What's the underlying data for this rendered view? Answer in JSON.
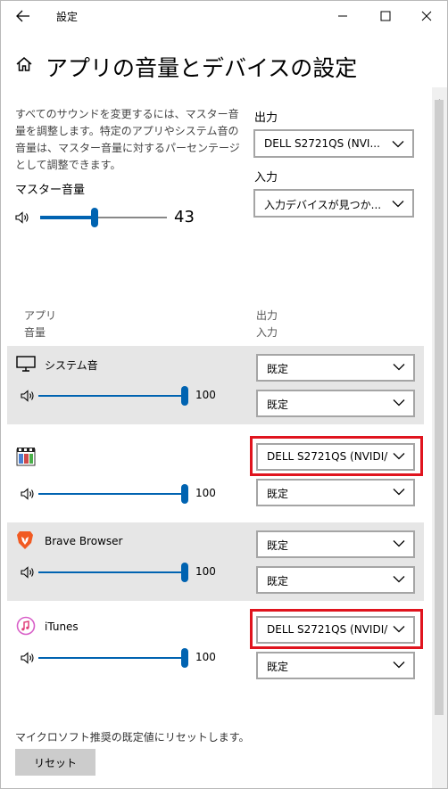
{
  "window": {
    "title": "設定"
  },
  "page": {
    "title": "アプリの音量とデバイスの設定"
  },
  "master": {
    "description": "すべてのサウンドを変更するには、マスター音量を調整します。特定のアプリやシステム音の音量は、マスター音量に対するパーセンテージとして調整できます。",
    "label": "マスター音量",
    "value": "43",
    "level": 43
  },
  "output": {
    "label": "出力",
    "selected": "DELL S2721QS (NVI..."
  },
  "input": {
    "label": "入力",
    "selected": "入力デバイスが見つか..."
  },
  "columns": {
    "app": "アプリ",
    "volume": "音量",
    "output": "出力",
    "input": "入力"
  },
  "apps": [
    {
      "name": "システム音",
      "icon": "monitor-icon",
      "volume": "100",
      "level": 100,
      "output": "既定",
      "input": "既定"
    },
    {
      "name": "",
      "icon": "media-player-classic-icon",
      "volume": "100",
      "level": 100,
      "output": "DELL S2721QS (NVIDI/",
      "input": "既定"
    },
    {
      "name": "Brave Browser",
      "icon": "brave-lion-icon",
      "volume": "100",
      "level": 100,
      "output": "既定",
      "input": "既定"
    },
    {
      "name": "iTunes",
      "icon": "itunes-icon",
      "volume": "100",
      "level": 100,
      "output": "DELL S2721QS (NVIDI/",
      "input": "既定"
    }
  ],
  "reset": {
    "description": "マイクロソフト推奨の既定値にリセットします。",
    "button": "リセット"
  },
  "colors": {
    "accent": "#0063b1",
    "highlight": "#e0141e",
    "row_gray": "#e6e6e6"
  }
}
